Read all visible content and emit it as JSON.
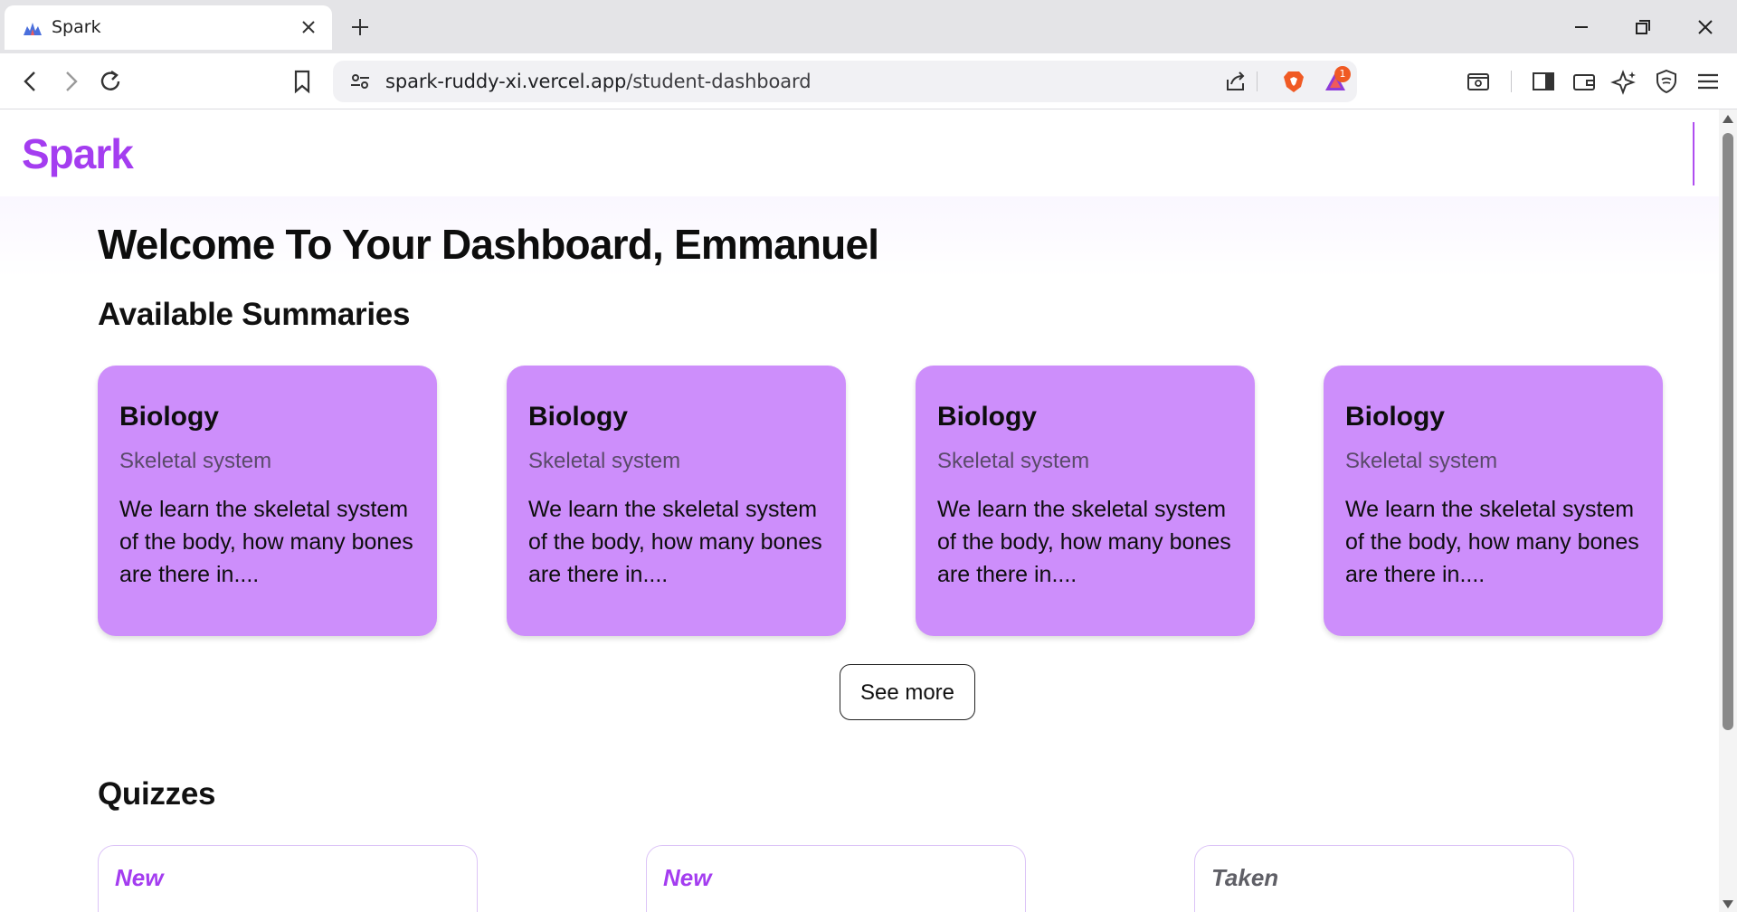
{
  "browser": {
    "tab_title": "Spark",
    "url_host": "spark-ruddy-xi.vercel.app",
    "url_path": "/student-dashboard",
    "notification_count": "1"
  },
  "header": {
    "logo": "Spark"
  },
  "main": {
    "welcome": "Welcome To Your Dashboard, Emmanuel",
    "summaries_title": "Available Summaries",
    "summaries": [
      {
        "subject": "Biology",
        "topic": "Skeletal system",
        "description": "We learn the skeletal system of the body, how many bones are there in...."
      },
      {
        "subject": "Biology",
        "topic": "Skeletal system",
        "description": "We learn the skeletal system of the body, how many bones are there in...."
      },
      {
        "subject": "Biology",
        "topic": "Skeletal system",
        "description": "We learn the skeletal system of the body, how many bones are there in...."
      },
      {
        "subject": "Biology",
        "topic": "Skeletal system",
        "description": "We learn the skeletal system of the body, how many bones are there in...."
      }
    ],
    "see_more_label": "See more",
    "quizzes_title": "Quizzes",
    "quizzes": [
      {
        "status": "New",
        "color": "#a43df0"
      },
      {
        "status": "New",
        "color": "#a43df0"
      },
      {
        "status": "Taken",
        "color": "#5f5f66"
      }
    ]
  },
  "colors": {
    "brand": "#a43df0",
    "card_bg": "#cd8efb"
  }
}
